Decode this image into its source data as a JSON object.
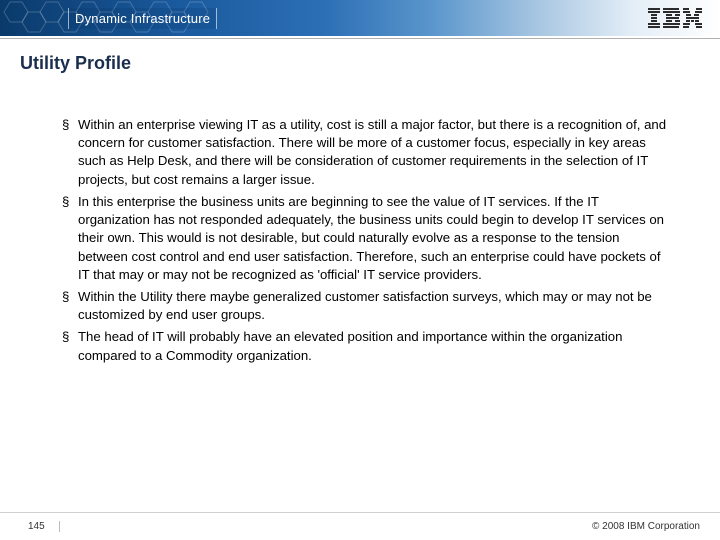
{
  "header": {
    "banner_title": "Dynamic Infrastructure",
    "logo_label": "IBM"
  },
  "slide": {
    "title": "Utility Profile",
    "bullets": [
      "Within an enterprise viewing IT as a utility, cost is still a major factor, but there is a recognition of, and concern for customer satisfaction. There will be more of a customer focus, especially in key areas such as Help Desk, and there will be consideration of customer requirements in the selection of IT projects, but cost remains a larger issue.",
      "In this enterprise the business units are beginning to see the value of IT services. If the IT organization has not responded adequately, the business units could begin to develop IT services on their own. This would is not desirable, but could naturally evolve as a response to the tension between cost control and end user satisfaction. Therefore, such an enterprise could have pockets of IT that may or may not be recognized as 'official' IT service providers.",
      "Within the Utility there maybe generalized customer satisfaction surveys, which may or may not be customized by end user groups.",
      "The head of IT will probably have an elevated position and importance within the organization compared to a Commodity organization."
    ]
  },
  "footer": {
    "page_number": "145",
    "copyright": "© 2008 IBM Corporation"
  }
}
